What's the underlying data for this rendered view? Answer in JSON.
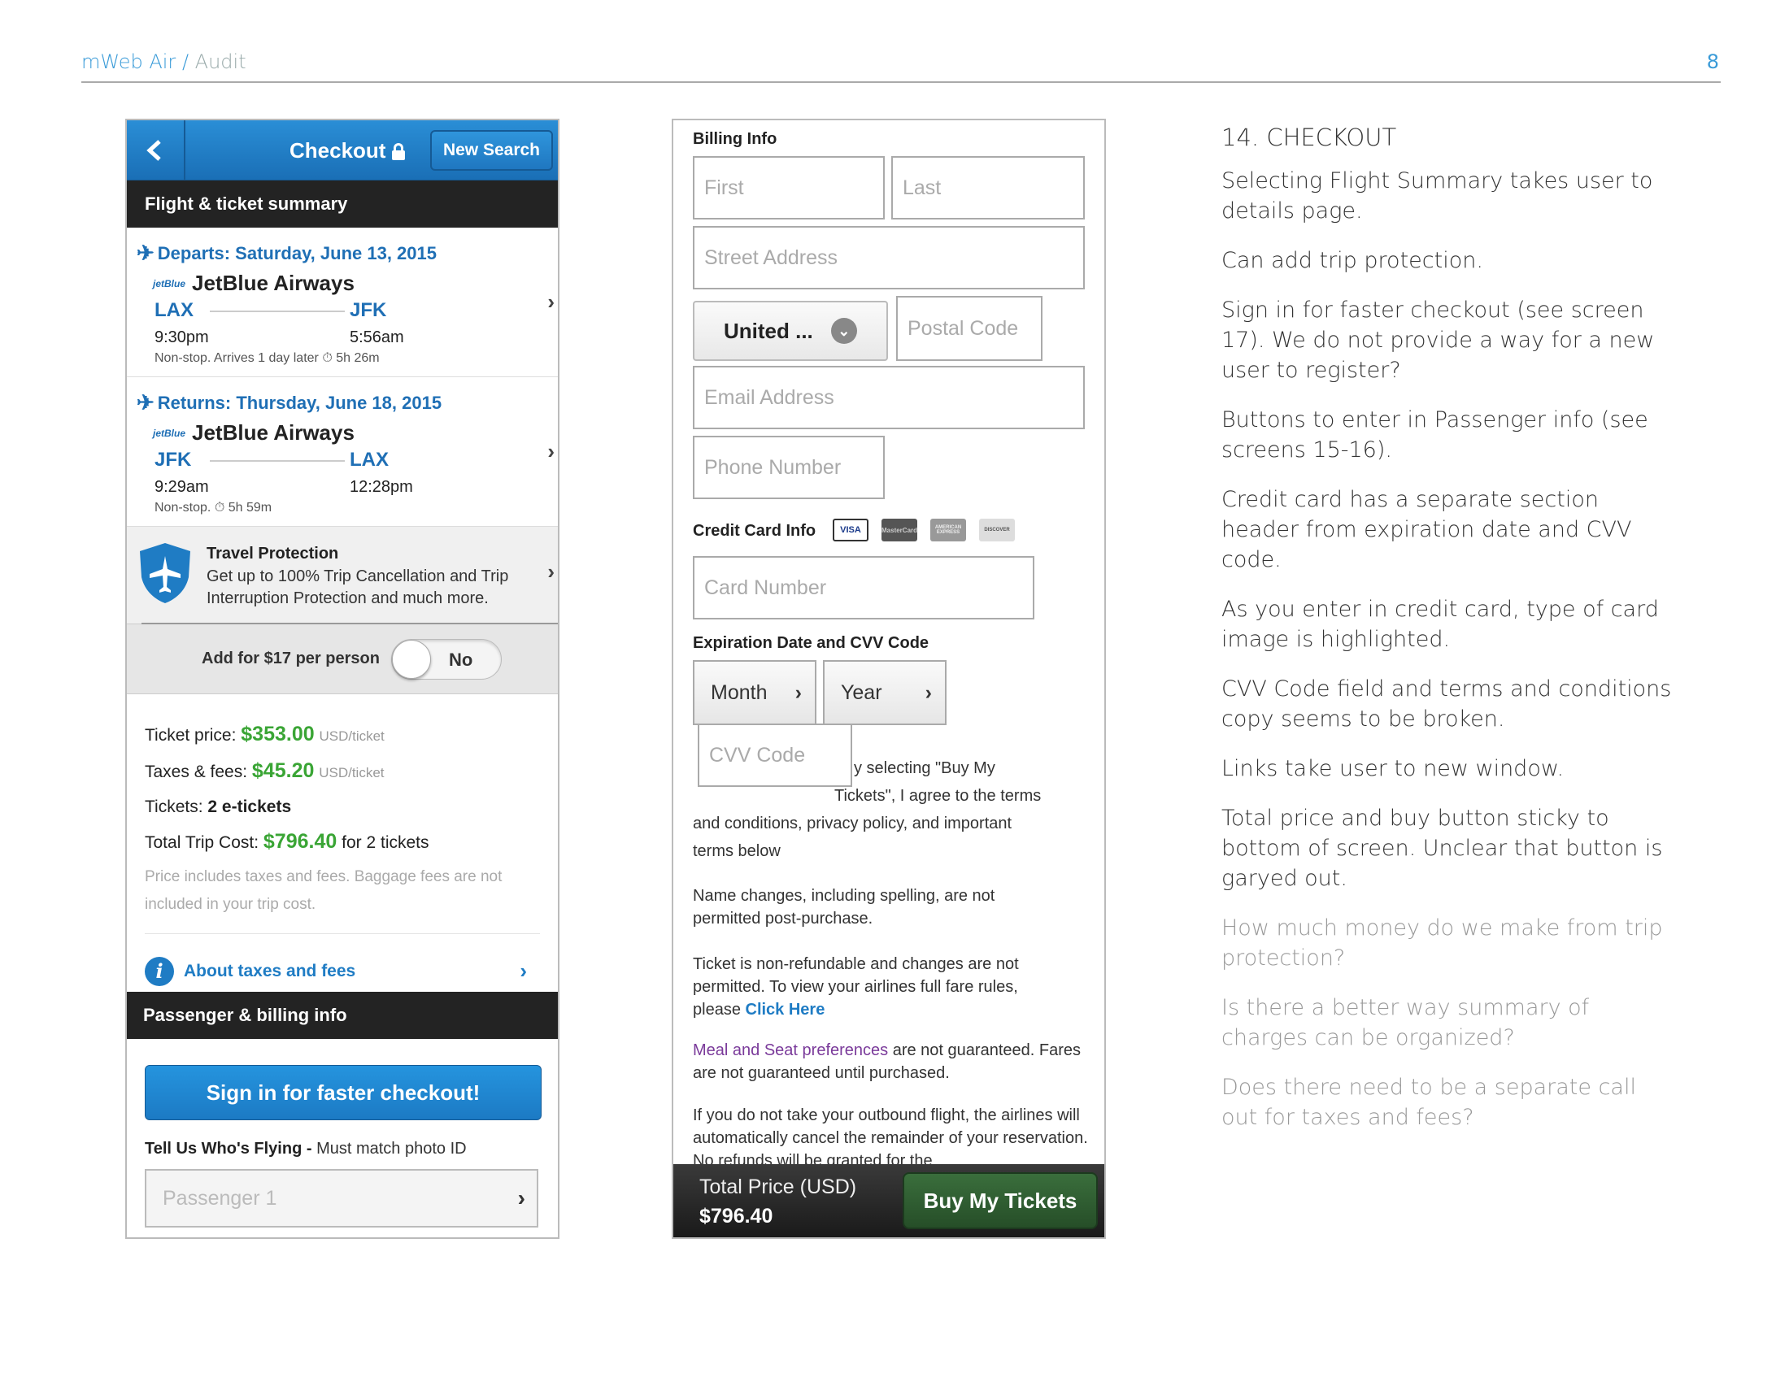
{
  "header": {
    "brand": "mWeb Air",
    "separator": "/",
    "section": "Audit",
    "page_number": "8"
  },
  "phone1": {
    "title": "Checkout",
    "new_search": "New Search",
    "summary_header": "Flight & ticket summary",
    "departs": {
      "label": "Departs: Saturday, June 13, 2015",
      "airline_logo": "jetBlue",
      "airline": "JetBlue Airways",
      "from": "LAX",
      "to": "JFK",
      "dep_time": "9:30pm",
      "arr_time": "5:56am",
      "note": "Non-stop. Arrives 1 day later ⏱ 5h 26m"
    },
    "returns": {
      "label": "Returns: Thursday, June 18, 2015",
      "airline_logo": "jetBlue",
      "airline": "JetBlue Airways",
      "from": "JFK",
      "to": "LAX",
      "dep_time": "9:29am",
      "arr_time": "12:28pm",
      "note": "Non-stop. ⏱ 5h 59m"
    },
    "travel_protection": {
      "title": "Travel Protection",
      "desc": "Get up to 100% Trip Cancellation and Trip Interruption Protection and much more."
    },
    "add_label": "Add for $17 per person",
    "toggle_value": "No",
    "ticket_price_label": "Ticket price:",
    "ticket_price": "$353.00",
    "ticket_unit": "USD/ticket",
    "taxes_label": "Taxes & fees:",
    "taxes": "$45.20",
    "taxes_unit": "USD/ticket",
    "tickets_label": "Tickets:",
    "tickets": "2 e-tickets",
    "total_label": "Total Trip Cost:",
    "total": "$796.40",
    "total_suffix": "for 2 tickets",
    "fine_print": "Price includes taxes and fees. Baggage fees are not included in your trip cost.",
    "about_link": "About taxes and fees",
    "billing_header": "Passenger & billing info",
    "signin_button": "Sign in for faster checkout!",
    "tell_label": "Tell Us Who's Flying -",
    "tell_note": "Must match photo ID",
    "passenger_placeholder": "Passenger 1"
  },
  "phone2": {
    "billing_label": "Billing Info",
    "first_placeholder": "First",
    "last_placeholder": "Last",
    "street_placeholder": "Street Address",
    "country_value": "United ...",
    "postal_placeholder": "Postal Code",
    "email_placeholder": "Email Address",
    "phone_placeholder": "Phone Number",
    "cc_label": "Credit Card Info",
    "cards": [
      "VISA",
      "MasterCard",
      "AMERICAN EXPRESS",
      "DISCOVER"
    ],
    "card_placeholder": "Card Number",
    "exp_label": "Expiration Date and CVV Code",
    "month": "Month",
    "year": "Year",
    "cvv_placeholder": "CVV Code",
    "terms_line1": "y selecting \"Buy My",
    "terms_line2": "Tickets\", I agree to the terms",
    "terms_line3": "and conditions, privacy policy, and important",
    "terms_line4": "terms below",
    "name_changes": "Name changes, including spelling, are not permitted post-purchase.",
    "nonrefund": "Ticket is non-refundable and changes are not permitted. To view your airlines full fare rules, please",
    "click_here": "Click Here",
    "meal_link": "Meal and Seat preferences",
    "meal_rest": "are not guaranteed. Fares are not guaranteed until purchased.",
    "outbound": "If you do not take your outbound flight, the airlines will automatically cancel the remainder of your reservation. No refunds will be granted for the",
    "total_label": "Total Price (USD)",
    "total_value": "$796.40",
    "buy_button": "Buy My Tickets"
  },
  "notes": {
    "heading": "14. CHECKOUT",
    "items": [
      "Selecting Flight Summary takes user to details page.",
      "Can add trip protection.",
      "Sign in for faster checkout (see screen 17). We do not provide a way for a new user to register?",
      "Buttons to enter in Passenger info (see screens 15-16).",
      "Credit card has a separate section header from expiration date and CVV code.",
      "As you enter in credit card, type of card image is highlighted.",
      "CVV Code field and terms and conditions copy seems to be broken.",
      "Links take user to new window.",
      "Total price and buy button sticky to bottom of screen. Unclear that button is garyed out."
    ],
    "questions": [
      "How much money do we make from trip protection?",
      "Is there a better way summary of charges can be organized?",
      "Does there need to be a separate call out for taxes and fees?"
    ]
  }
}
